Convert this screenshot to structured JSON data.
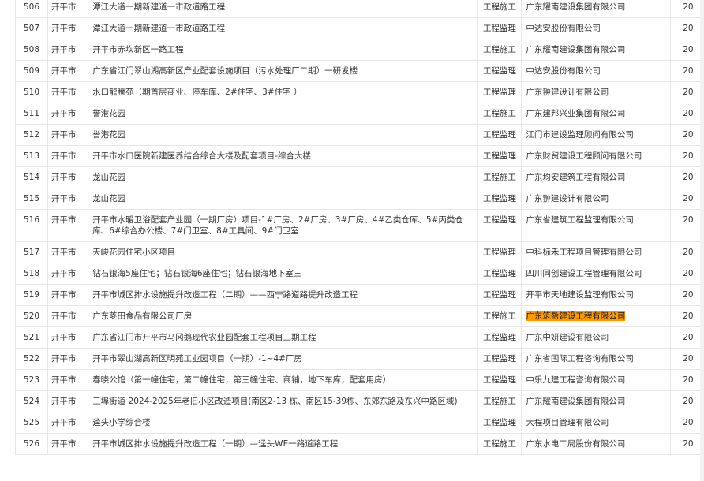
{
  "rows": [
    {
      "no": "506",
      "city": "开平市",
      "project": "潭江大道一期新建道一市政道路工程",
      "type": "工程施工",
      "unit": "广东耀南建设集团有限公司",
      "score": "20"
    },
    {
      "no": "507",
      "city": "开平市",
      "project": "潭江大道一期新建道一市政道路工程",
      "type": "工程监理",
      "unit": "中达安股份有限公司",
      "score": "20"
    },
    {
      "no": "508",
      "city": "开平市",
      "project": "开平市赤坎新区一路工程",
      "type": "工程施工",
      "unit": "广东耀南建设集团有限公司",
      "score": "20"
    },
    {
      "no": "509",
      "city": "开平市",
      "project": "广东省江门翠山湖高新区产业配套设施项目（污水处理厂二期）一研发楼",
      "type": "工程监理",
      "unit": "中达安股份有限公司",
      "score": "20"
    },
    {
      "no": "510",
      "city": "开平市",
      "project": "水口龍騰苑（期首层商业、停车库、2#住宅、3#住宅 ）",
      "type": "工程监理",
      "unit": "广东翀建设计有限公司",
      "score": "20"
    },
    {
      "no": "511",
      "city": "开平市",
      "project": "誉港花园",
      "type": "工程施工",
      "unit": "广东建邦兴业集团有限公司",
      "score": "20"
    },
    {
      "no": "512",
      "city": "开平市",
      "project": "誉港花园",
      "type": "工程监理",
      "unit": "江门市建设监理顾问有限公司",
      "score": "20"
    },
    {
      "no": "513",
      "city": "开平市",
      "project": "开平市水口医院新建医养结合综合大楼及配套项目-综合大楼",
      "type": "工程监理",
      "unit": "广东财贸建设工程顾问有限公司",
      "score": "20"
    },
    {
      "no": "514",
      "city": "开平市",
      "project": "龙山花园",
      "type": "工程施工",
      "unit": "广东均安建筑工程有限公司",
      "score": "20"
    },
    {
      "no": "515",
      "city": "开平市",
      "project": "龙山花园",
      "type": "工程监理",
      "unit": "广东翀建设计有限公司",
      "score": "20"
    },
    {
      "no": "516",
      "city": "开平市",
      "project": "开平市水暖卫浴配套产业园（一期厂房）项目-1#厂房、2#厂房、3#厂房、4#乙类仓库、5#丙类仓库、6#综合办公楼、7#门卫室、8#工具间、9#门卫室",
      "type": "工程监理",
      "unit": "广东省建筑工程监理有限公司",
      "score": "20"
    },
    {
      "no": "517",
      "city": "开平市",
      "project": "天峻花园住宅小区项目",
      "type": "工程监理",
      "unit": "中科标禾工程项目管理有限公司",
      "score": "20"
    },
    {
      "no": "518",
      "city": "开平市",
      "project": "钻石银海5座住宅；钻石银海6座住宅；钻石银海地下室三",
      "type": "工程监理",
      "unit": "四川同创建设工程管理有限公司",
      "score": "20"
    },
    {
      "no": "519",
      "city": "开平市",
      "project": "开平市城区排水设施提升改造工程（二期）——西宁路道路提升改造工程",
      "type": "工程监理",
      "unit": "开平市天地建设监理有限公司",
      "score": "20"
    },
    {
      "no": "520",
      "city": "开平市",
      "project": "广东菱田食品有限公司厂房",
      "type": "工程施工",
      "unit": "广东筑盈建设工程有限公司",
      "score": "20",
      "highlight": true
    },
    {
      "no": "521",
      "city": "开平市",
      "project": "广东省江门市开平市马冈鹅现代农业园配套工程项目三期工程",
      "type": "工程监理",
      "unit": "广东中妍建设有限公司",
      "score": "20"
    },
    {
      "no": "522",
      "city": "开平市",
      "project": "开平市翠山湖高新区明苑工业园项目（一期）-1~4#厂房",
      "type": "工程监理",
      "unit": "广东省国际工程咨询有限公司",
      "score": "20"
    },
    {
      "no": "523",
      "city": "开平市",
      "project": "春晓公馆（第一幢住宅，第二幢住宅，第三幢住宅、商铺，地下车库，配套用房）",
      "type": "工程监理",
      "unit": "中乐九建工程咨询有限公司",
      "score": "20"
    },
    {
      "no": "524",
      "city": "开平市",
      "project": "三埠街道 2024-2025年老旧小区改造项目(南区2-13 栋、南区15-39栋、东郊东路及东兴中路区域)",
      "type": "工程施工",
      "unit": "广东耀南建设集团有限公司",
      "score": "20"
    },
    {
      "no": "525",
      "city": "开平市",
      "project": "迳头小学综合楼",
      "type": "工程监理",
      "unit": "大程项目管理有限公司",
      "score": "20"
    },
    {
      "no": "526",
      "city": "开平市",
      "project": "开平市城区排水设施提升改造工程（一期）—迳头WE一路道路工程",
      "type": "工程施工",
      "unit": "广东水电二局股份有限公司",
      "score": "20"
    }
  ]
}
